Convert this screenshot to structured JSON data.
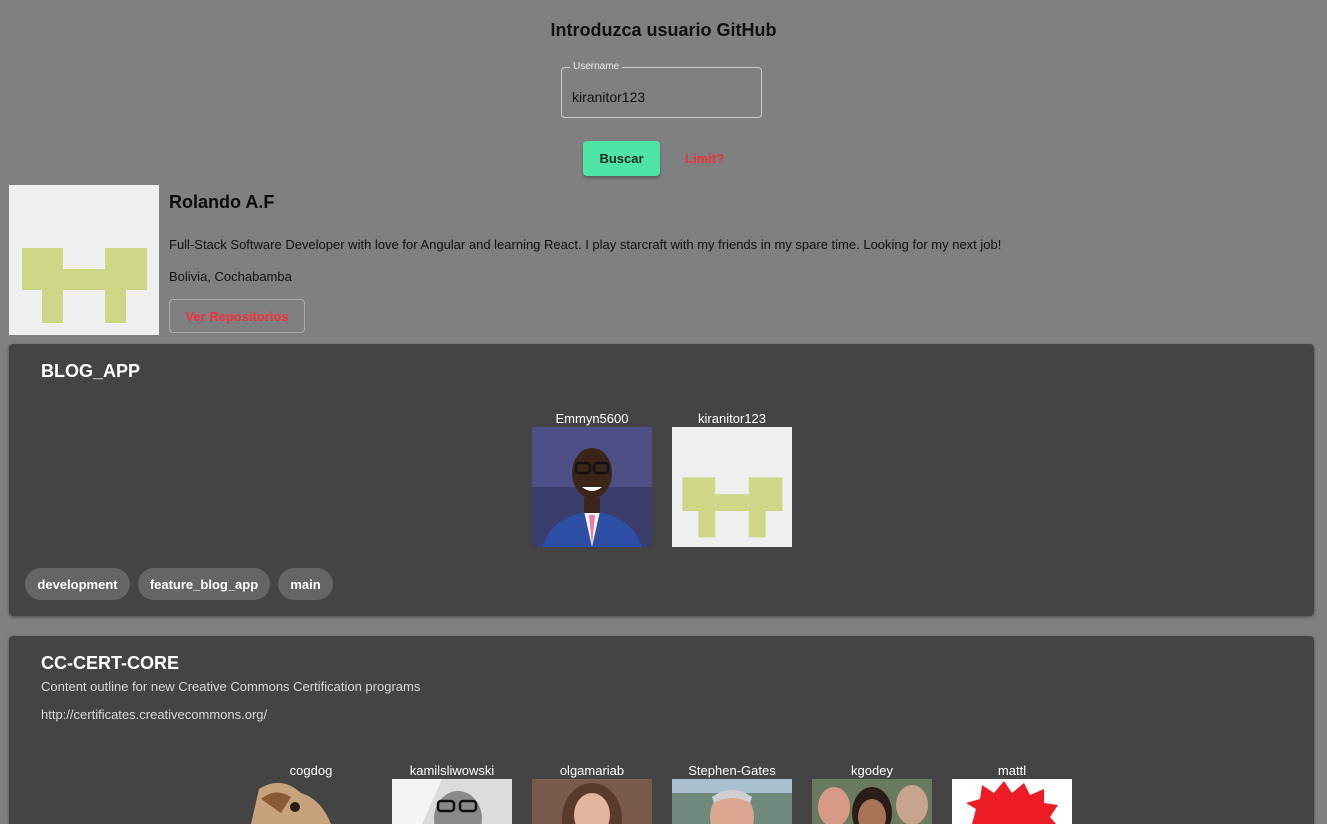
{
  "header": {
    "title": "Introduzca usuario GitHub"
  },
  "search": {
    "label": "Username",
    "value": "kiranitor123"
  },
  "actions": {
    "search_label": "Buscar",
    "limit_label": "Limit?"
  },
  "profile": {
    "name": "Rolando A.F",
    "bio": "Full-Stack Software Developer with love for Angular and learning React. I play starcraft with my friends in my spare time. Looking for my next job!",
    "location": "Bolivia, Cochabamba",
    "repos_button_label": "Ver Repositorios",
    "avatar_icon": "identicon"
  },
  "repos": [
    {
      "name": "BLOG_APP",
      "contributors": [
        {
          "login": "Emmyn5600",
          "avatar": "person-photo"
        },
        {
          "login": "kiranitor123",
          "avatar": "identicon"
        }
      ],
      "branches": [
        "development",
        "feature_blog_app",
        "main"
      ]
    },
    {
      "name": "CC-CERT-CORE",
      "description": "Content outline for new Creative Commons Certification programs",
      "url": "http://certificates.creativecommons.org/",
      "contributors": [
        {
          "login": "cogdog",
          "avatar": "dog-photo"
        },
        {
          "login": "kamilsliwowski",
          "avatar": "person-photo"
        },
        {
          "login": "olgamariab",
          "avatar": "person-photo"
        },
        {
          "login": "Stephen-Gates",
          "avatar": "person-photo"
        },
        {
          "login": "kgodey",
          "avatar": "person-photo"
        },
        {
          "login": "mattl",
          "avatar": "badge-logo"
        }
      ]
    }
  ],
  "colors": {
    "background": "#808080",
    "card": "#444444",
    "accent": "#4ee4a5",
    "danger": "#f0313c",
    "identicon": "#cfd686"
  }
}
